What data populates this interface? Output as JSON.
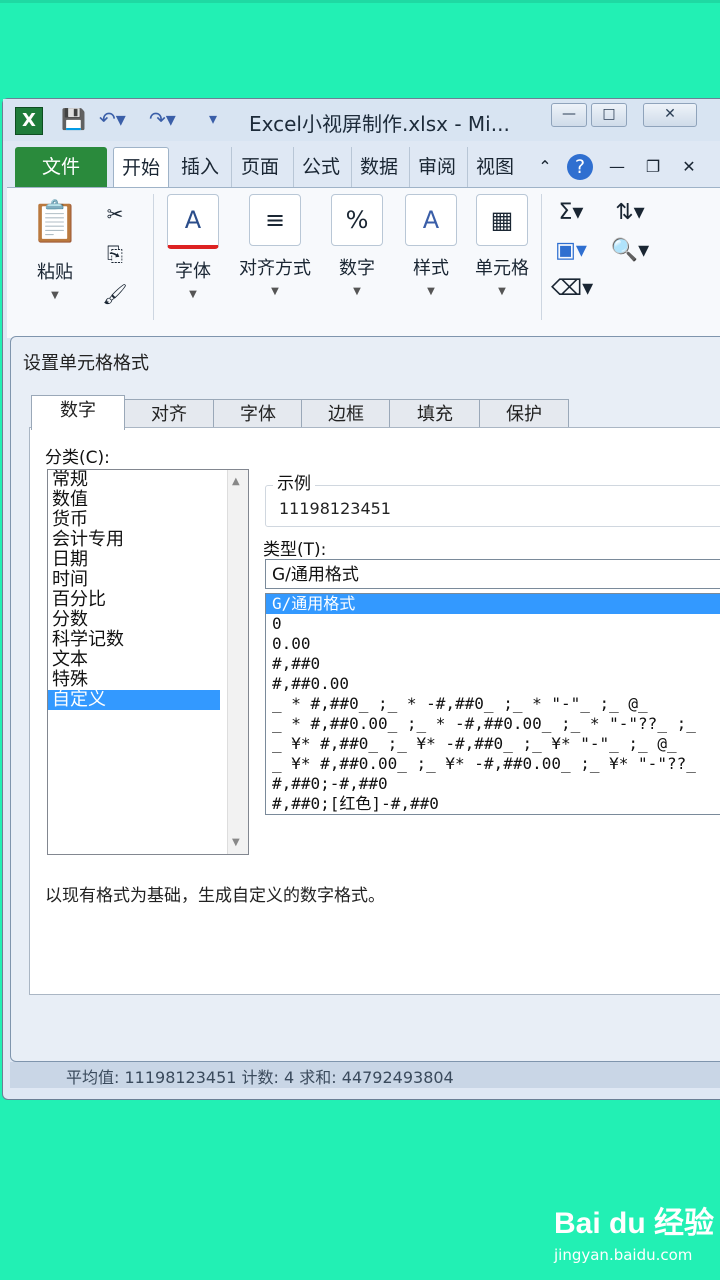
{
  "window": {
    "title": "Excel小视屏制作.xlsx  -  Mi...",
    "min_label": "—",
    "max_label": "□",
    "close_label": "✕"
  },
  "ribbon": {
    "file_tab": "文件",
    "tabs": [
      "开始",
      "插入",
      "页面",
      "公式",
      "数据",
      "审阅",
      "视图"
    ],
    "groups": {
      "paste": "粘贴",
      "font": "字体",
      "align": "对齐方式",
      "number": "数字",
      "style": "样式",
      "cells": "单元格"
    }
  },
  "dialog": {
    "title": "设置单元格格式",
    "tabs": [
      "数字",
      "对齐",
      "字体",
      "边框",
      "填充",
      "保护"
    ],
    "category_label": "分类(C):",
    "categories": [
      "常规",
      "数值",
      "货币",
      "会计专用",
      "日期",
      "时间",
      "百分比",
      "分数",
      "科学记数",
      "文本",
      "特殊",
      "自定义"
    ],
    "selected_category": "自定义",
    "sample_label": "示例",
    "sample_value": "11198123451",
    "type_label": "类型(T):",
    "type_input": "G/通用格式",
    "type_items": [
      "G/通用格式",
      "0",
      "0.00",
      "#,##0",
      "#,##0.00",
      "_ * #,##0_ ;_ * -#,##0_ ;_ * \"-\"_ ;_ @_",
      "_ * #,##0.00_ ;_ * -#,##0.00_ ;_ * \"-\"??_ ;_",
      "_ ¥* #,##0_ ;_ ¥* -#,##0_ ;_ ¥* \"-\"_ ;_ @_",
      "_ ¥* #,##0.00_ ;_ ¥* -#,##0.00_ ;_ ¥* \"-\"??_",
      "#,##0;-#,##0",
      "#,##0;[红色]-#,##0"
    ],
    "description": "以现有格式为基础，生成自定义的数字格式。"
  },
  "statusbar": {
    "text": "平均值: 11198123451    计数: 4    求和: 44792493804"
  },
  "watermark": {
    "brand": "Bai du 经验",
    "url": "jingyan.baidu.com"
  }
}
